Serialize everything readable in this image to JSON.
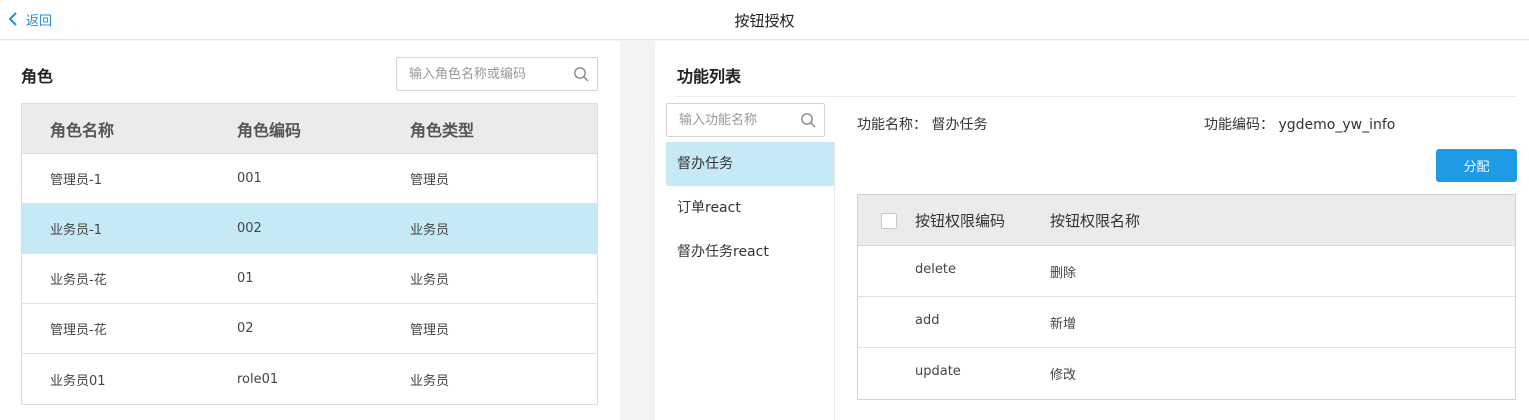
{
  "header": {
    "back_label": "返回",
    "title": "按钮授权"
  },
  "roles": {
    "title": "角色",
    "search_placeholder": "输入角色名称或编码",
    "columns": [
      "角色名称",
      "角色编码",
      "角色类型"
    ],
    "rows": [
      {
        "name": "管理员-1",
        "code": "001",
        "type": "管理员",
        "selected": false
      },
      {
        "name": "业务员-1",
        "code": "002",
        "type": "业务员",
        "selected": true
      },
      {
        "name": "业务员-花",
        "code": "01",
        "type": "业务员",
        "selected": false
      },
      {
        "name": "管理员-花",
        "code": "02",
        "type": "管理员",
        "selected": false
      },
      {
        "name": "业务员01",
        "code": "role01",
        "type": "业务员",
        "selected": false
      }
    ]
  },
  "functions": {
    "title": "功能列表",
    "search_placeholder": "输入功能名称",
    "items": [
      {
        "label": "督办任务",
        "selected": true
      },
      {
        "label": "订单react",
        "selected": false
      },
      {
        "label": "督办任务react",
        "selected": false
      }
    ],
    "detail": {
      "name_label": "功能名称：",
      "name_value": "督办任务",
      "code_label": "功能编码：",
      "code_value": "ygdemo_yw_info"
    },
    "assign_label": "分配",
    "permissions": {
      "columns": [
        "按钮权限编码",
        "按钮权限名称"
      ],
      "rows": [
        {
          "code": "delete",
          "name": "删除"
        },
        {
          "code": "add",
          "name": "新增"
        },
        {
          "code": "update",
          "name": "修改"
        }
      ]
    }
  },
  "colors": {
    "accent": "#1e9be5",
    "selected_row": "#c5e9f5",
    "header_bg": "#ebebeb"
  }
}
